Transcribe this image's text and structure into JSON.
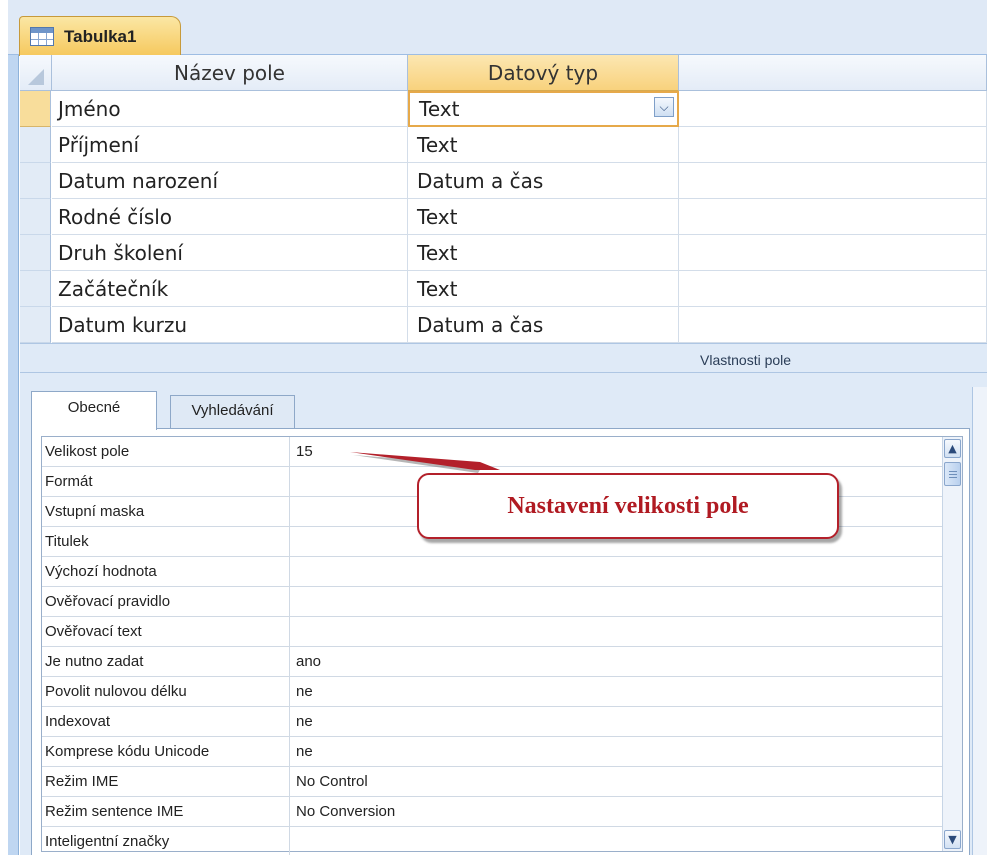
{
  "document_tab": {
    "title": "Tabulka1",
    "icon": "table-icon"
  },
  "grid": {
    "headers": {
      "field_name": "Název pole",
      "data_type": "Datový typ"
    },
    "rows": [
      {
        "name": "Jméno",
        "type": "Text",
        "active": true
      },
      {
        "name": "Příjmení",
        "type": "Text"
      },
      {
        "name": "Datum narození",
        "type": "Datum a čas"
      },
      {
        "name": "Rodné číslo",
        "type": "Text"
      },
      {
        "name": "Druh školení",
        "type": "Text"
      },
      {
        "name": "Začátečník",
        "type": "Text"
      },
      {
        "name": "Datum kurzu",
        "type": "Datum a čas"
      }
    ],
    "dropdown_icon": "chevron-down-icon"
  },
  "properties": {
    "title": "Vlastnosti pole",
    "tabs": [
      {
        "label": "Obecné",
        "active": true
      },
      {
        "label": "Vyhledávání",
        "active": false
      }
    ],
    "rows": [
      {
        "label": "Velikost pole",
        "value": "15"
      },
      {
        "label": "Formát",
        "value": ""
      },
      {
        "label": "Vstupní maska",
        "value": ""
      },
      {
        "label": "Titulek",
        "value": ""
      },
      {
        "label": "Výchozí hodnota",
        "value": ""
      },
      {
        "label": "Ověřovací pravidlo",
        "value": ""
      },
      {
        "label": "Ověřovací text",
        "value": ""
      },
      {
        "label": "Je nutno zadat",
        "value": "ano"
      },
      {
        "label": "Povolit nulovou délku",
        "value": "ne"
      },
      {
        "label": "Indexovat",
        "value": "ne"
      },
      {
        "label": "Komprese kódu Unicode",
        "value": "ne"
      },
      {
        "label": "Režim IME",
        "value": "No Control"
      },
      {
        "label": "Režim sentence IME",
        "value": "No Conversion"
      },
      {
        "label": "Inteligentní značky",
        "value": ""
      }
    ]
  },
  "callout": {
    "text": "Nastavení velikosti pole",
    "color": "#b01a22"
  },
  "colors": {
    "accent": "#f8d27d",
    "frame": "#bfd6f1",
    "callout_border": "#b3202a"
  }
}
